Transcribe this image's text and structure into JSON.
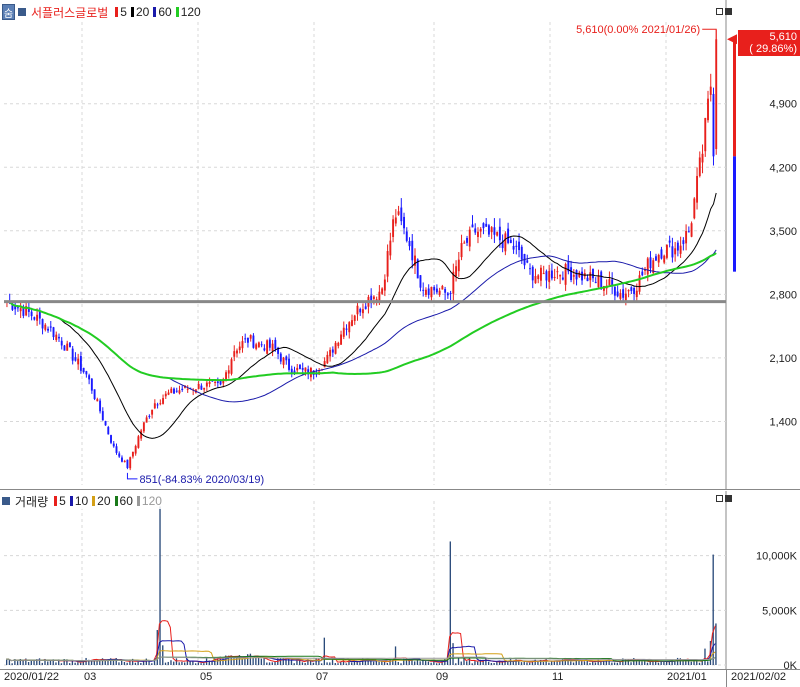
{
  "price_panel": {
    "collapse_button": "숨",
    "stock_name": "서플러스글로벌",
    "ma_legend": [
      {
        "label": "5",
        "color": "#e8201c"
      },
      {
        "label": "20",
        "color": "#000000"
      },
      {
        "label": "60",
        "color": "#1a1aaa"
      },
      {
        "label": "120",
        "color": "#22cc22"
      }
    ],
    "y_ticks": [
      "4,900",
      "4,200",
      "3,500",
      "2,800",
      "2,100",
      "1,400"
    ],
    "current_price_line1": "5,610",
    "current_price_line2": "( 29.86%)",
    "high_annotation": "5,610(0.00% 2021/01/26)",
    "low_annotation": "851(-84.83% 2020/03/19)",
    "support_line_level": 2720
  },
  "volume_panel": {
    "title": "거래량",
    "ma_legend": [
      {
        "label": "5",
        "color": "#e8201c"
      },
      {
        "label": "10",
        "color": "#1a1aaa"
      },
      {
        "label": "20",
        "color": "#d4a017"
      },
      {
        "label": "60",
        "color": "#1a7a1a"
      },
      {
        "label": "120",
        "color": "#999999"
      }
    ],
    "y_ticks": [
      "10,000K",
      "5,000K",
      "0K"
    ]
  },
  "x_axis": {
    "start_label": "2020/01/22",
    "end_label": "2021/02/02",
    "month_labels": [
      "03",
      "05",
      "07",
      "09",
      "11",
      "2021/01"
    ]
  },
  "colors": {
    "up": "#e8201c",
    "down": "#1a1aff",
    "ma5": "#e8201c",
    "ma20": "#000000",
    "ma60": "#1a1aaa",
    "ma120": "#22cc22",
    "grid": "#d0d0d0"
  },
  "chart_data": {
    "type": "candlestick",
    "title": "서플러스글로벌",
    "y_range": [
      700,
      5800
    ],
    "weekly_close": [
      2720,
      2650,
      2560,
      2450,
      2300,
      2100,
      1900,
      1500,
      1100,
      900,
      1300,
      1600,
      1700,
      1750,
      1780,
      1800,
      1780,
      2200,
      2300,
      2250,
      2200,
      2000,
      1950,
      1950,
      2100,
      2400,
      2600,
      2750,
      2850,
      3700,
      3400,
      2900,
      2850,
      2800,
      3300,
      3500,
      3450,
      3400,
      3300,
      3050,
      3000,
      3050,
      3050,
      3000,
      2950,
      2900,
      2800,
      2900,
      3150,
      3300,
      3300,
      3500,
      4400,
      5610
    ],
    "ma_levels": {
      "ma120_start": 2350,
      "ma120_end": 3100
    }
  }
}
